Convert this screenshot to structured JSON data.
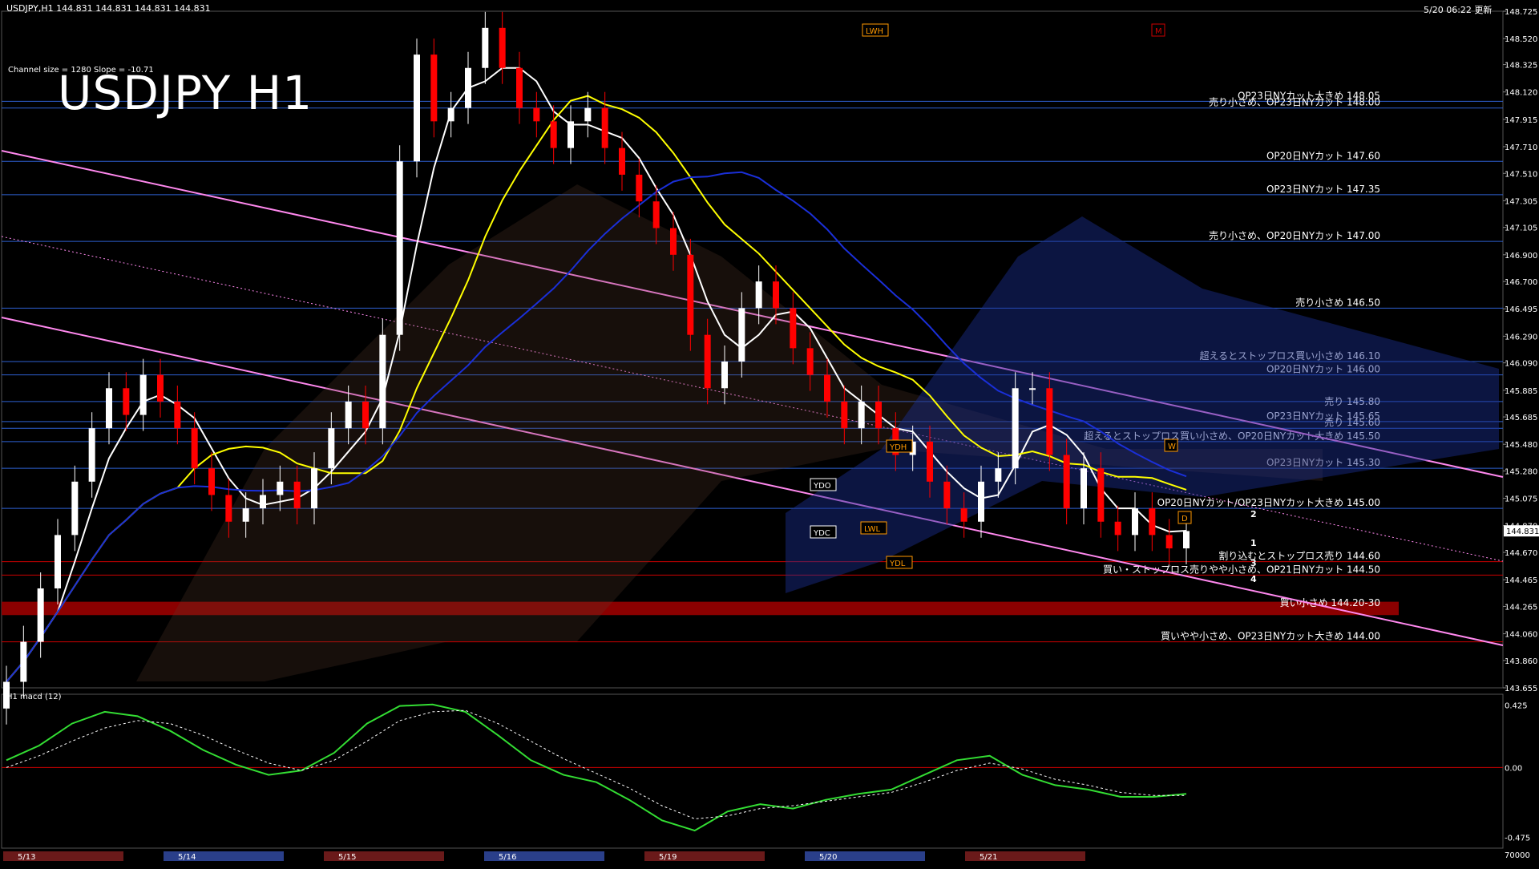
{
  "header": {
    "symbol_line": "USDJPY,H1  144.831 144.831 144.831 144.831",
    "timestamp": "5/20 06:22 更新",
    "channel_info": "Channel size = 1280 Slope = -10.71",
    "big_title": "USDJPY H1",
    "macd_label": "H1  macd (12)"
  },
  "colors": {
    "background": "#000000",
    "grid_blue": "#2e5fd0",
    "level_red": "#cc0000",
    "channel_pink": "#ff88ee",
    "ma_yellow": "#ffff00",
    "ma_white": "#ffffff",
    "ma_blue": "#1a2fd8",
    "tenkan_green": "#22bb22",
    "bull_candle": "#ffffff",
    "bear_candle": "#ff0000",
    "macd_green": "#33dd33",
    "macd_pink": "#ff77aa",
    "orange_box": "#ff9900"
  },
  "chart_data": [
    {
      "type": "candlestick",
      "title": "USDJPY H1",
      "x_labels": [
        "5/13",
        "5/14",
        "5/15",
        "5/16",
        "5/19",
        "5/20",
        "5/21"
      ],
      "ylim": [
        143.655,
        148.725
      ],
      "y_ticks": [
        "148.725",
        "148.520",
        "148.325",
        "148.120",
        "147.915",
        "147.710",
        "147.510",
        "147.305",
        "147.105",
        "146.900",
        "146.700",
        "146.495",
        "146.290",
        "146.090",
        "145.885",
        "145.685",
        "145.480",
        "145.280",
        "145.075",
        "144.870",
        "144.670",
        "144.465",
        "144.265",
        "144.060",
        "143.860",
        "143.655"
      ],
      "current_price": "144.831",
      "close_series": [
        143.7,
        144.0,
        144.4,
        144.8,
        145.2,
        145.6,
        145.9,
        145.7,
        146.0,
        145.8,
        145.6,
        145.3,
        145.1,
        144.9,
        145.0,
        145.1,
        145.2,
        145.0,
        145.3,
        145.6,
        145.8,
        145.6,
        146.3,
        147.6,
        148.4,
        147.9,
        148.0,
        148.3,
        148.6,
        148.3,
        148.0,
        147.9,
        147.7,
        147.9,
        148.0,
        147.7,
        147.5,
        147.3,
        147.1,
        146.9,
        146.3,
        145.9,
        146.1,
        146.5,
        146.7,
        146.5,
        146.2,
        146.0,
        145.8,
        145.6,
        145.8,
        145.6,
        145.4,
        145.5,
        145.2,
        145.0,
        144.9,
        145.2,
        145.3,
        145.9,
        145.9,
        145.4,
        145.0,
        145.3,
        144.9,
        144.8,
        145.0,
        144.8,
        144.7,
        144.83
      ],
      "levels": [
        {
          "label": "OP23日NYカット大きめ 148.05",
          "price": 148.05
        },
        {
          "label": "売り小さめ、OP23日NYカット 148.00",
          "price": 148.0
        },
        {
          "label": "OP20日NYカット 147.60",
          "price": 147.6
        },
        {
          "label": "OP23日NYカット 147.35",
          "price": 147.35
        },
        {
          "label": "売り小さめ、OP20日NYカット 147.00",
          "price": 147.0
        },
        {
          "label": "売り小さめ 146.50",
          "price": 146.5
        },
        {
          "label": "超えるとストップロス買い小さめ 146.10",
          "price": 146.1
        },
        {
          "label": "OP20日NYカット 146.00",
          "price": 146.0
        },
        {
          "label": "売り 145.80",
          "price": 145.8
        },
        {
          "label": "OP23日NYカット 145.65",
          "price": 145.65
        },
        {
          "label": "売り 145.60",
          "price": 145.6
        },
        {
          "label": "超えるとストップロス買い小さめ、OP20日NYカット大きめ 145.50",
          "price": 145.5
        },
        {
          "label": "OP23日NYカット 145.30",
          "price": 145.3
        },
        {
          "label": "OP20日NYカット/OP23日NYカット大きめ 145.00",
          "price": 145.0
        },
        {
          "label": "割り込むとストップロス売り 144.60",
          "price": 144.6
        },
        {
          "label": "買い・ストップロス売りやや小さめ、OP21日NYカット 144.50",
          "price": 144.5
        },
        {
          "label": "買い小さめ 144.20-30",
          "price": 144.25
        },
        {
          "label": "買いやや小さめ、OP23日NYカット大きめ 144.00",
          "price": 144.0
        }
      ],
      "markers": [
        "LWH",
        "YDH",
        "YDO",
        "YDC",
        "LWL",
        "YDL",
        "W",
        "D",
        "M"
      ],
      "projection_labels": [
        "1",
        "2",
        "3",
        "4"
      ]
    },
    {
      "type": "line",
      "title": "H1  macd (12)",
      "y_ticks": [
        "0.425",
        "0.00",
        "-0.475"
      ],
      "ylim": [
        -0.55,
        0.5
      ],
      "macd_series": [
        0.05,
        0.15,
        0.3,
        0.38,
        0.35,
        0.25,
        0.12,
        0.02,
        -0.05,
        -0.02,
        0.1,
        0.3,
        0.42,
        0.43,
        0.38,
        0.22,
        0.05,
        -0.05,
        -0.1,
        -0.22,
        -0.36,
        -0.43,
        -0.3,
        -0.25,
        -0.28,
        -0.22,
        -0.18,
        -0.15,
        -0.05,
        0.05,
        0.08,
        -0.05,
        -0.12,
        -0.15,
        -0.2,
        -0.2,
        -0.18
      ],
      "signal_series": [
        0.0,
        0.08,
        0.18,
        0.27,
        0.32,
        0.3,
        0.22,
        0.12,
        0.03,
        -0.02,
        0.05,
        0.18,
        0.32,
        0.38,
        0.39,
        0.3,
        0.18,
        0.06,
        -0.04,
        -0.14,
        -0.26,
        -0.35,
        -0.33,
        -0.28,
        -0.26,
        -0.23,
        -0.2,
        -0.17,
        -0.1,
        -0.02,
        0.03,
        -0.01,
        -0.08,
        -0.12,
        -0.17,
        -0.19,
        -0.19
      ],
      "extra_value": "70000"
    }
  ]
}
